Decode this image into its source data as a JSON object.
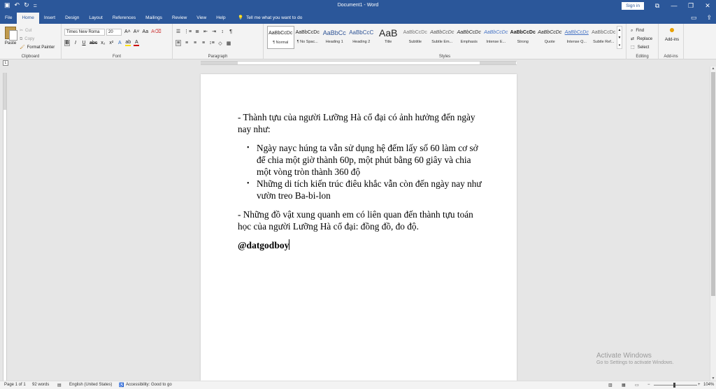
{
  "titlebar": {
    "title": "Document1 - Word",
    "signin": "Sign in",
    "qa_icons": [
      "save-icon",
      "undo-icon",
      "redo-icon",
      "customize-icon"
    ],
    "qa_glyphs": [
      "▣",
      "↶",
      "↻",
      "="
    ],
    "window_glyphs": [
      "⧉",
      "—",
      "❐",
      "✕"
    ]
  },
  "menu": {
    "tabs": [
      "File",
      "Home",
      "Insert",
      "Design",
      "Layout",
      "References",
      "Mailings",
      "Review",
      "View",
      "Help"
    ],
    "active_tab": "Home",
    "tell_me": "Tell me what you want to do"
  },
  "ribbon": {
    "clipboard": {
      "paste": "Paste",
      "cut": "Cut",
      "copy": "Copy",
      "format_painter": "Format Painter",
      "label": "Clipboard"
    },
    "font": {
      "name": "Times New Roma",
      "size": "20",
      "label": "Font"
    },
    "paragraph": {
      "label": "Paragraph"
    },
    "styles": {
      "label": "Styles",
      "items": [
        {
          "preview": "AaBbCcDc",
          "name": "¶ Normal"
        },
        {
          "preview": "AaBbCcDc",
          "name": "¶ No Spac..."
        },
        {
          "preview": "AaBbCc",
          "name": "Heading 1"
        },
        {
          "preview": "AaBbCcC",
          "name": "Heading 2"
        },
        {
          "preview": "AaB",
          "name": "Title"
        },
        {
          "preview": "AaBbCcDc",
          "name": "Subtitle"
        },
        {
          "preview": "AaBbCcDc",
          "name": "Subtle Em..."
        },
        {
          "preview": "AaBbCcDc",
          "name": "Emphasis"
        },
        {
          "preview": "AaBbCcDc",
          "name": "Intense E..."
        },
        {
          "preview": "AaBbCcDc",
          "name": "Strong"
        },
        {
          "preview": "AaBbCcDc",
          "name": "Quote"
        },
        {
          "preview": "AaBbCcDc",
          "name": "Intense Q..."
        },
        {
          "preview": "AaBbCcDc",
          "name": "Subtle Ref..."
        }
      ]
    },
    "editing": {
      "find": "Find",
      "replace": "Replace",
      "select": "Select",
      "label": "Editing"
    },
    "addins": {
      "button": "Add-ins",
      "label": "Add-ins"
    }
  },
  "document": {
    "para1": "- Thành tựu của người Lưỡng Hà cổ đại có ảnh hưởng đến ngày nay như:",
    "bullets": [
      "Ngày nayc húng ta vẫn sử dụng hệ đếm lấy số 60 làm cơ sở để chia một giờ thành 60p, một phút bằng 60 giây và chia một vòng tròn thành 360 độ",
      "Những di tích kiến trúc điêu khắc vẫn còn đến ngày nay như vườn treo Ba-bi-lon"
    ],
    "para2": "- Những đồ vật xung quanh em có liên quan đến thành tựu toán học của người Lưỡng Hà cổ đại: đồng đồ, đo độ.",
    "signature": "@datgodboy"
  },
  "watermark": {
    "line1": "Activate Windows",
    "line2": "Go to Settings to activate Windows."
  },
  "status": {
    "page": "Page 1 of 1",
    "words": "92 words",
    "language": "English (United States)",
    "accessibility": "Accessibility: Good to go",
    "zoom": "104%"
  }
}
